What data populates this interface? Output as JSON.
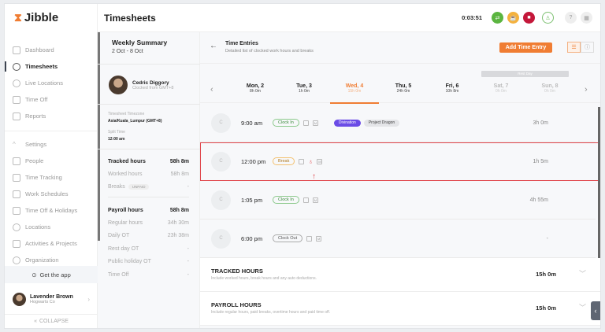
{
  "app": {
    "name": "Jibble",
    "page_title": "Timesheets",
    "timer": "0:03:51"
  },
  "sidebar": {
    "items": [
      {
        "label": "Dashboard"
      },
      {
        "label": "Timesheets"
      },
      {
        "label": "Live Locations"
      },
      {
        "label": "Time Off"
      },
      {
        "label": "Reports"
      }
    ],
    "settings_items": [
      {
        "label": "Settings"
      },
      {
        "label": "People"
      },
      {
        "label": "Time Tracking"
      },
      {
        "label": "Work Schedules"
      },
      {
        "label": "Time Off & Holidays"
      },
      {
        "label": "Locations"
      },
      {
        "label": "Activities & Projects"
      },
      {
        "label": "Organization"
      }
    ],
    "get_app": "Get the app",
    "user": {
      "name": "Lavender Brown",
      "org": "Hogwarts Co"
    },
    "collapse": "COLLAPSE"
  },
  "summary": {
    "title": "Weekly Summary",
    "range": "2 Oct - 8 Oct",
    "employee": {
      "name": "Cedric Diggory",
      "sub": "Clocked from GMT+8"
    },
    "tz_label": "Timesheet Timezone",
    "tz_value": "Asia/Kuala_Lumpur (GMT+8)",
    "split_label": "Split Time",
    "split_value": "12:00 am",
    "tracked": [
      {
        "label": "Tracked hours",
        "value": "58h 8m"
      },
      {
        "label": "Worked hours",
        "value": "58h 8m"
      },
      {
        "label": "Breaks",
        "value": "-",
        "badge": "UNPAID"
      }
    ],
    "payroll": [
      {
        "label": "Payroll hours",
        "value": "58h 8m"
      },
      {
        "label": "Regular hours",
        "value": "34h 30m"
      },
      {
        "label": "Daily OT",
        "value": "23h 38m"
      },
      {
        "label": "Rest day OT",
        "value": "-"
      },
      {
        "label": "Public holiday OT",
        "value": "-"
      },
      {
        "label": "Time Off",
        "value": "-"
      }
    ]
  },
  "entries_header": {
    "title": "Time Entries",
    "subtitle": "Detailed list of clocked work hours and breaks",
    "add_label": "Add Time Entry"
  },
  "days": {
    "rest_label": "Rest Day",
    "list": [
      {
        "name": "Mon, 2",
        "hours": "8h 0m"
      },
      {
        "name": "Tue, 3",
        "hours": "1h 0m"
      },
      {
        "name": "Wed, 4",
        "hours": "15h 0m"
      },
      {
        "name": "Thu, 5",
        "hours": "24h 0m"
      },
      {
        "name": "Fri, 6",
        "hours": "10h 8m"
      },
      {
        "name": "Sat, 7",
        "hours": "0h 0m"
      },
      {
        "name": "Sun, 8",
        "hours": "0h 0m"
      }
    ]
  },
  "entries": [
    {
      "avatar": "C",
      "time": "9:00 am",
      "type": "Clock In",
      "activity": "Divination",
      "project": "Project Dragon",
      "duration": "3h 0m"
    },
    {
      "avatar": "C",
      "time": "12:00 pm",
      "type": "Break",
      "duration": "1h 5m"
    },
    {
      "avatar": "C",
      "time": "1:05 pm",
      "type": "Clock In",
      "duration": "4h 55m"
    },
    {
      "avatar": "C",
      "time": "6:00 pm",
      "type": "Clock Out",
      "duration": "-"
    }
  ],
  "totals": [
    {
      "title": "TRACKED HOURS",
      "desc": "Include worked hours, break hours and any auto deductions.",
      "value": "15h 0m"
    },
    {
      "title": "PAYROLL HOURS",
      "desc": "Include regular hours, paid breaks, overtime hours and paid time off.",
      "value": "15h 0m"
    }
  ],
  "colors": {
    "accent": "#f07d33",
    "highlight": "#e0464b",
    "activity": "#6b4ce6"
  }
}
